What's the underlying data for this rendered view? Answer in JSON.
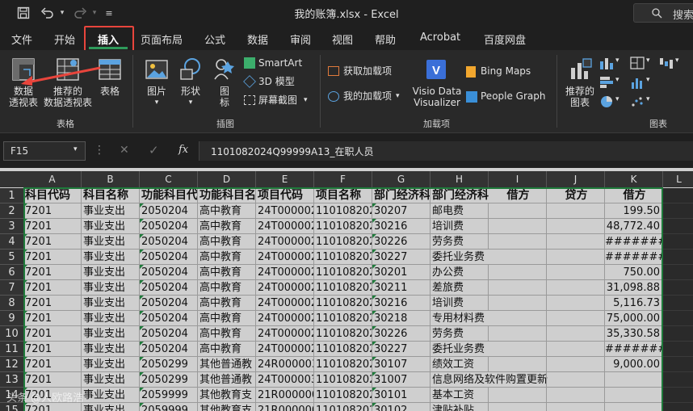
{
  "window": {
    "title": "我的账簿.xlsx  -  Excel",
    "search_label": "搜索"
  },
  "tabs": [
    {
      "label": "文件"
    },
    {
      "label": "开始"
    },
    {
      "label": "插入"
    },
    {
      "label": "页面布局"
    },
    {
      "label": "公式"
    },
    {
      "label": "数据"
    },
    {
      "label": "审阅"
    },
    {
      "label": "视图"
    },
    {
      "label": "帮助"
    },
    {
      "label": "Acrobat"
    },
    {
      "label": "百度网盘"
    }
  ],
  "ribbon": {
    "pivot_table_line1": "数据",
    "pivot_table_line2": "透视表",
    "recommended_pivot_line1": "推荐的",
    "recommended_pivot_line2": "数据透视表",
    "table": "表格",
    "group_tables": "表格",
    "pictures": "图片",
    "shapes": "形状",
    "icons_line1": "图",
    "icons_line2": "标",
    "smartart": "SmartArt",
    "models_3d": "3D 模型",
    "screenshot": "屏幕截图",
    "group_illustrations": "插图",
    "get_addins": "获取加载项",
    "my_addins": "我的加载项",
    "visio_line1": "Visio Data",
    "visio_line2": "Visualizer",
    "bing_maps": "Bing Maps",
    "people_graph": "People Graph",
    "group_addins": "加载项",
    "recommended_charts_line1": "推荐的",
    "recommended_charts_line2": "图表",
    "group_charts": "图表"
  },
  "formula_bar": {
    "name_box": "F15",
    "fx": "fx",
    "formula": "1101082024Q99999A13_在职人员"
  },
  "columns": [
    "A",
    "B",
    "C",
    "D",
    "E",
    "F",
    "G",
    "H",
    "I",
    "J",
    "K",
    "L"
  ],
  "rows": [
    {
      "n": "1",
      "cells": [
        "科目代码",
        "科目名称",
        "功能科目代",
        "功能科目名",
        "项目代码",
        "项目名称",
        "部门经济科",
        "部门经济科",
        "借方",
        "贷方",
        "借方"
      ]
    },
    {
      "n": "2",
      "cells": [
        "7201",
        "事业支出",
        "2050204",
        "高中教育",
        "24T000002",
        "1101082024",
        "30207",
        "邮电费",
        "",
        "",
        "199.50"
      ]
    },
    {
      "n": "3",
      "cells": [
        "7201",
        "事业支出",
        "2050204",
        "高中教育",
        "24T000002",
        "1101082024",
        "30216",
        "培训费",
        "",
        "",
        "48,772.40"
      ]
    },
    {
      "n": "4",
      "cells": [
        "7201",
        "事业支出",
        "2050204",
        "高中教育",
        "24T000002",
        "1101082024",
        "30226",
        "劳务费",
        "",
        "",
        "#######"
      ]
    },
    {
      "n": "5",
      "cells": [
        "7201",
        "事业支出",
        "2050204",
        "高中教育",
        "24T000002",
        "1101082024",
        "30227",
        "委托业务费",
        "",
        "",
        "#######"
      ]
    },
    {
      "n": "6",
      "cells": [
        "7201",
        "事业支出",
        "2050204",
        "高中教育",
        "24T000002",
        "1101082024",
        "30201",
        "办公费",
        "",
        "",
        "750.00"
      ]
    },
    {
      "n": "7",
      "cells": [
        "7201",
        "事业支出",
        "2050204",
        "高中教育",
        "24T000002",
        "1101082024",
        "30211",
        "差旅费",
        "",
        "",
        "31,098.88"
      ]
    },
    {
      "n": "8",
      "cells": [
        "7201",
        "事业支出",
        "2050204",
        "高中教育",
        "24T000002",
        "1101082024",
        "30216",
        "培训费",
        "",
        "",
        "5,116.73"
      ]
    },
    {
      "n": "9",
      "cells": [
        "7201",
        "事业支出",
        "2050204",
        "高中教育",
        "24T000002",
        "1101082024",
        "30218",
        "专用材料费",
        "",
        "",
        "75,000.00"
      ]
    },
    {
      "n": "10",
      "cells": [
        "7201",
        "事业支出",
        "2050204",
        "高中教育",
        "24T000002",
        "1101082024",
        "30226",
        "劳务费",
        "",
        "",
        "35,330.58"
      ]
    },
    {
      "n": "11",
      "cells": [
        "7201",
        "事业支出",
        "2050204",
        "高中教育",
        "24T000002",
        "1101082024",
        "30227",
        "委托业务费",
        "",
        "",
        "#######"
      ]
    },
    {
      "n": "12",
      "cells": [
        "7201",
        "事业支出",
        "2050299",
        "其他普通教",
        "24R000003",
        "1101082024",
        "30107",
        "绩效工资",
        "",
        "",
        "9,000.00"
      ]
    },
    {
      "n": "13",
      "cells": [
        "7201",
        "事业支出",
        "2050299",
        "其他普通教",
        "24T000003",
        "1101082024",
        "31007",
        "信息网络及软件购置更新",
        "",
        "",
        ""
      ]
    },
    {
      "n": "14",
      "cells": [
        "7201",
        "事业支出",
        "2059999",
        "其他教育支",
        "21R000000",
        "1101082024",
        "30101",
        "基本工资",
        "",
        "",
        ""
      ]
    },
    {
      "n": "15",
      "cells": [
        "7201",
        "事业支出",
        "2059999",
        "其他教育支",
        "21R000000",
        "1101082024",
        "30102",
        "津贴补贴",
        "",
        "",
        ""
      ]
    }
  ],
  "watermark": "头条 @人欧路浩",
  "colors": {
    "accent": "#2e9a5a",
    "highlight": "#e8453c",
    "cell_bg": "#cfcfcf"
  }
}
